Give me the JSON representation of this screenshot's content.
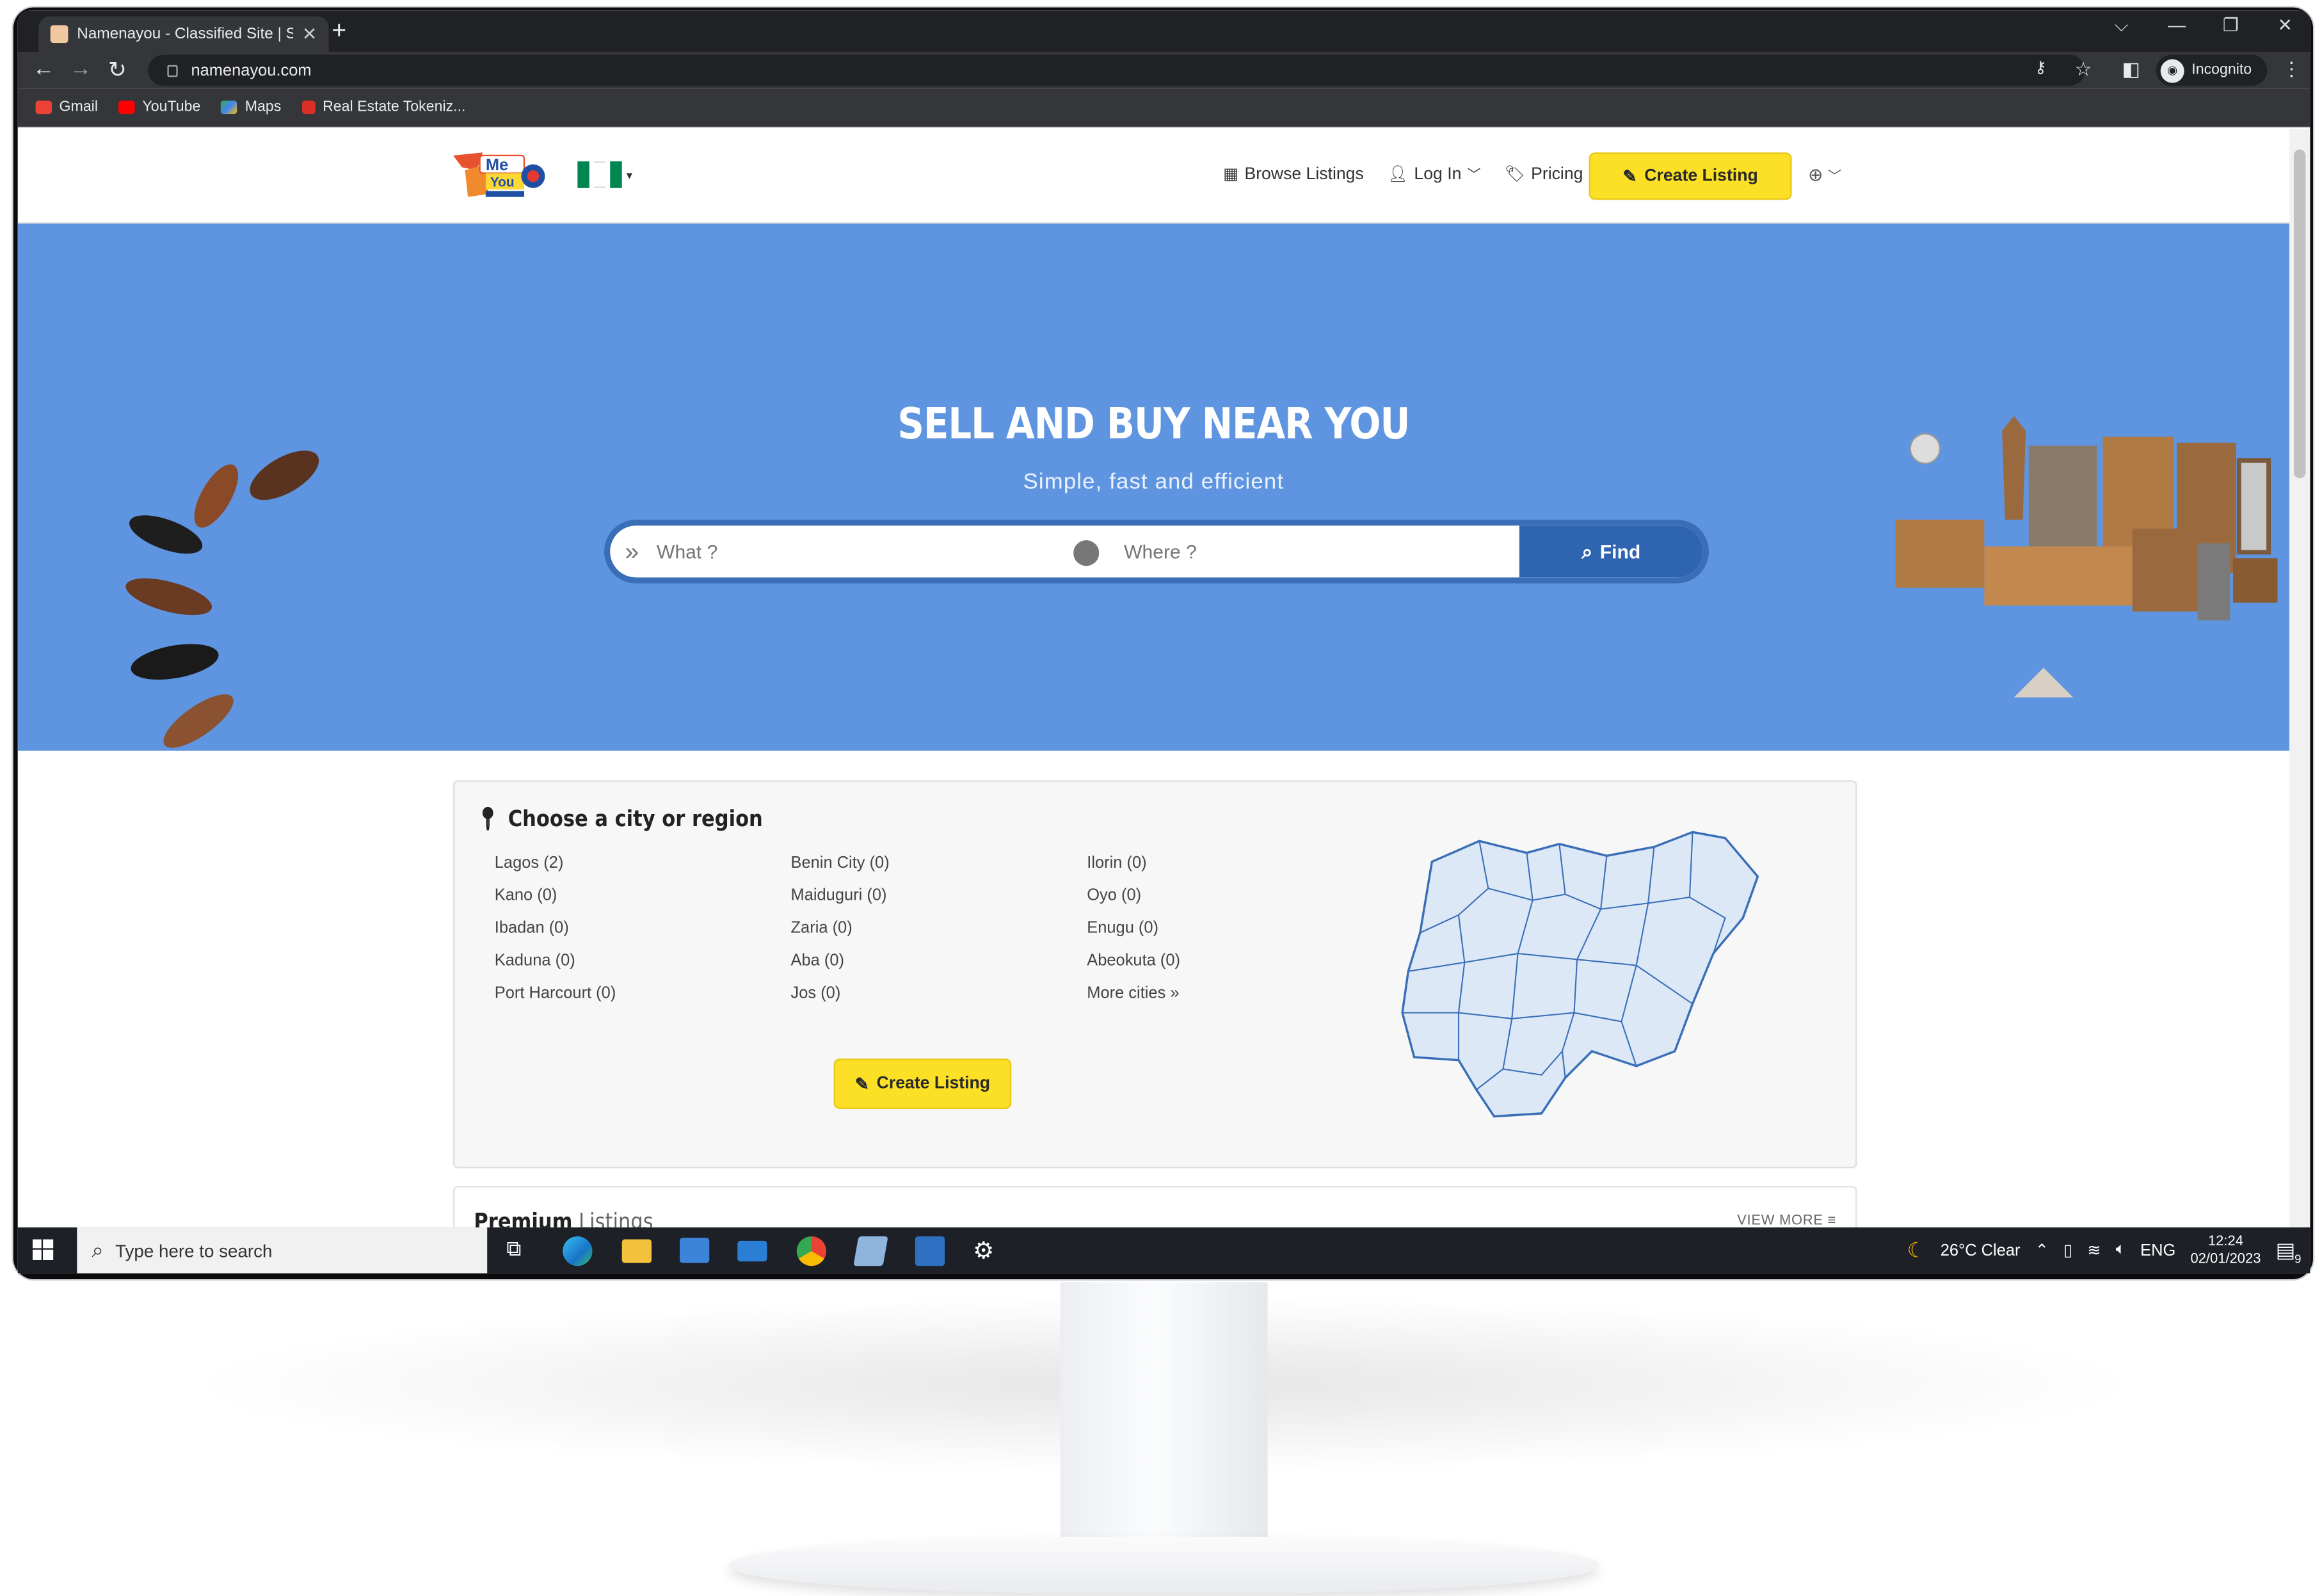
{
  "browser": {
    "tab_title": "Namenayou - Classified Site | Sell",
    "tab_close": "✕",
    "new_tab": "+",
    "url": "namenayou.com",
    "incognito_label": "Incognito",
    "bookmarks": [
      {
        "label": "Gmail",
        "color": "#ea4335"
      },
      {
        "label": "YouTube",
        "color": "#ff0000"
      },
      {
        "label": "Maps",
        "color": "#34a853"
      },
      {
        "label": "Real Estate Tokeniz...",
        "color": "#d93025"
      }
    ]
  },
  "site": {
    "logo_text": "Me You",
    "nav": {
      "browse": "Browse Listings",
      "login": "Log In",
      "pricing": "Pricing",
      "create": "Create Listing"
    },
    "hero": {
      "title": "SELL AND BUY NEAR YOU",
      "subtitle": "Simple, fast and efficient",
      "what_placeholder": "What ?",
      "where_placeholder": "Where ?",
      "find_label": "Find",
      "bg_color": "#5f95e0"
    },
    "cities": {
      "heading": "Choose a city or region",
      "col1": [
        "Lagos  (2)",
        "Kano  (0)",
        "Ibadan  (0)",
        "Kaduna  (0)",
        "Port Harcourt  (0)"
      ],
      "col2": [
        "Benin City  (0)",
        "Maiduguri  (0)",
        "Zaria  (0)",
        "Aba  (0)",
        "Jos  (0)"
      ],
      "col3": [
        "Ilorin  (0)",
        "Oyo  (0)",
        "Enugu  (0)",
        "Abeokuta  (0)",
        "More cities »"
      ],
      "create": "Create Listing"
    },
    "premium": {
      "title_bold": "Premium",
      "title_rest": " Listings",
      "view_more": "VIEW MORE ≡"
    }
  },
  "taskbar": {
    "search_placeholder": "Type here to search",
    "weather": "26°C  Clear",
    "lang": "ENG",
    "time": "12:24",
    "date": "02/01/2023",
    "notif_count": "9"
  }
}
